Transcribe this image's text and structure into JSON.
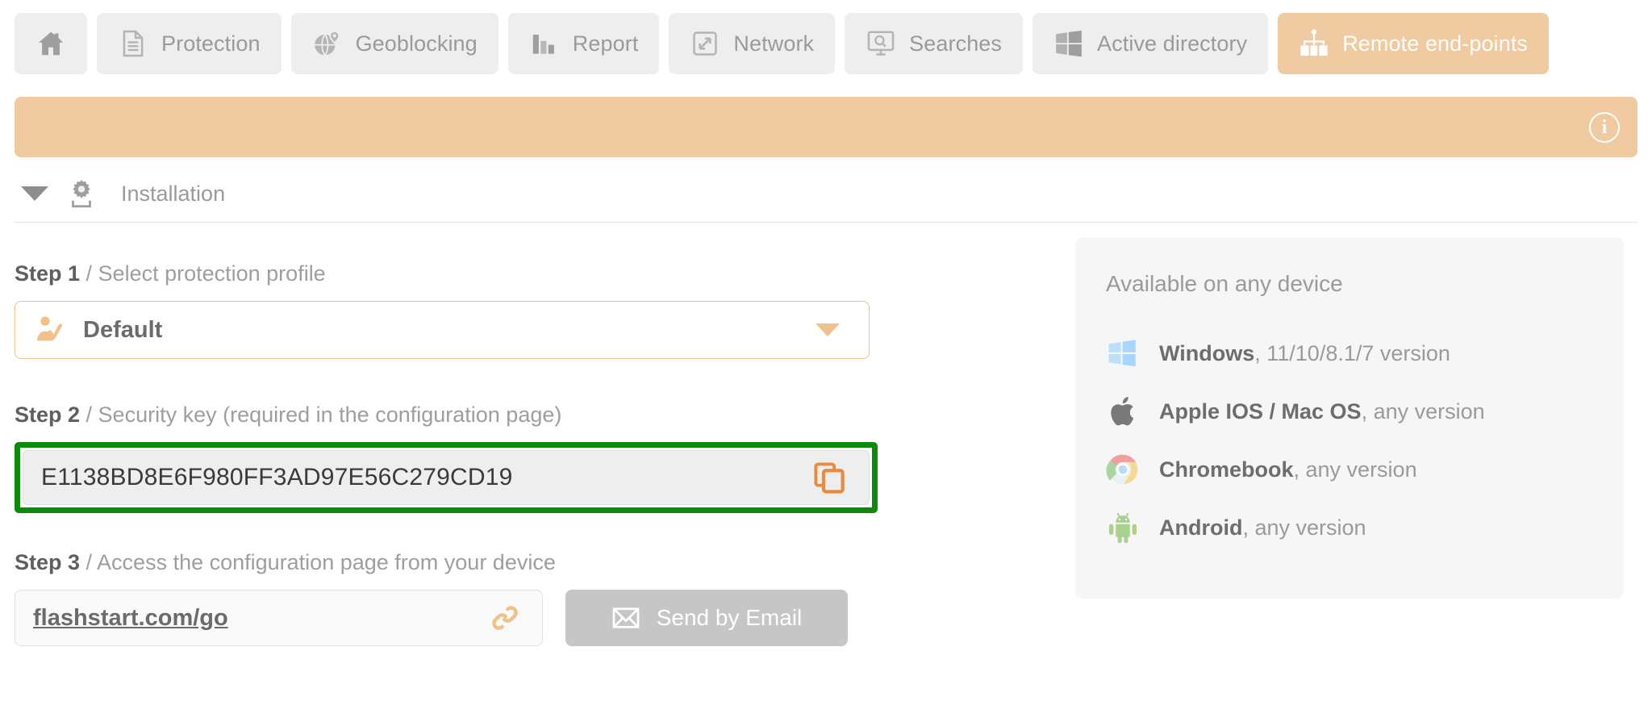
{
  "nav": {
    "tabs": [
      {
        "id": "home",
        "label": "",
        "icon": "home-icon",
        "active": false
      },
      {
        "id": "protection",
        "label": "Protection",
        "icon": "document-icon",
        "active": false
      },
      {
        "id": "geoblocking",
        "label": "Geoblocking",
        "icon": "globe-pin-icon",
        "active": false
      },
      {
        "id": "report",
        "label": "Report",
        "icon": "bar-chart-icon",
        "active": false
      },
      {
        "id": "network",
        "label": "Network",
        "icon": "network-arrows-icon",
        "active": false
      },
      {
        "id": "searches",
        "label": "Searches",
        "icon": "monitor-search-icon",
        "active": false
      },
      {
        "id": "activedirectory",
        "label": "Active directory",
        "icon": "windows-icon",
        "active": false
      },
      {
        "id": "remoteendpoints",
        "label": "Remote end-points",
        "icon": "endpoints-icon",
        "active": true
      }
    ]
  },
  "banner": {
    "text": "",
    "info_icon": "info-circle-icon",
    "color": "#f0caa0"
  },
  "section": {
    "title": "Installation",
    "icon": "gear-install-icon",
    "collapse_icon": "triangle-down-icon"
  },
  "steps": {
    "step1": {
      "number": "Step 1",
      "separator": " / ",
      "description": "Select protection profile",
      "profile": {
        "value": "Default",
        "icon": "user-check-icon",
        "caret": "chevron-down-icon"
      }
    },
    "step2": {
      "number": "Step 2",
      "separator": " / ",
      "description": "Security key (required in the configuration page)",
      "key_value": "E1138BD8E6F980FF3AD97E56C279CD19",
      "copy_icon": "copy-icon",
      "highlight_color": "#0b8a0b"
    },
    "step3": {
      "number": "Step 3",
      "separator": " / ",
      "description": "Access the configuration page from your device",
      "link_text": "flashstart.com/go",
      "link_icon": "chain-link-icon",
      "email_button_label": "Send by Email",
      "email_button_icon": "envelope-icon"
    }
  },
  "devices": {
    "title": "Available on any device",
    "items": [
      {
        "icon": "windows-logo-icon",
        "name": "Windows",
        "detail": ", 11/10/8.1/7 version"
      },
      {
        "icon": "apple-logo-icon",
        "name": "Apple IOS / Mac OS",
        "detail": ", any version"
      },
      {
        "icon": "chrome-logo-icon",
        "name": "Chromebook",
        "detail": ", any version"
      },
      {
        "icon": "android-logo-icon",
        "name": "Android",
        "detail": ", any version"
      }
    ]
  },
  "colors": {
    "accent": "#f0caa0",
    "accent_border": "#f0c189",
    "copy_icon": "#e88b41",
    "highlight": "#0b8a0b"
  }
}
